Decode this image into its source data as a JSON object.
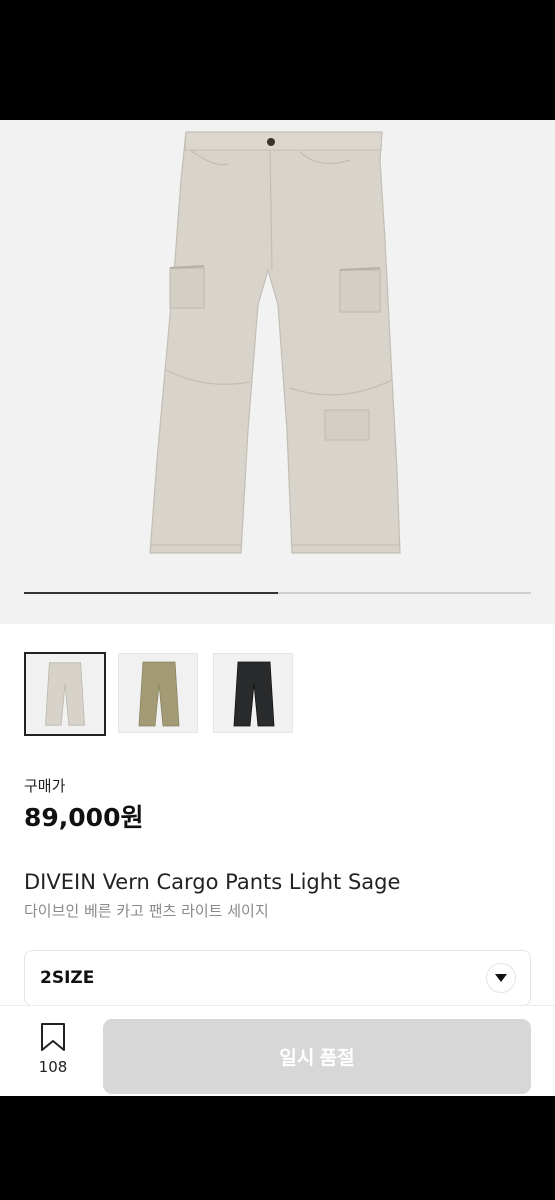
{
  "product": {
    "price_label": "구매가",
    "price": "89,000원",
    "name_en": "DIVEIN Vern Cargo Pants Light Sage",
    "name_ko": "다이브인 베른 카고 팬츠 라이트 세이지"
  },
  "gallery": {
    "progress": 0.5,
    "thumbnails": [
      {
        "color": "#d8d3ca",
        "selected": true
      },
      {
        "color": "#a39b76",
        "selected": false
      },
      {
        "color": "#2a2b2c",
        "selected": false
      }
    ]
  },
  "size_select": {
    "value": "2SIZE",
    "icon": "chevron-down-icon"
  },
  "bottom_bar": {
    "wishlist_count": "108",
    "wishlist_icon": "bookmark-icon",
    "action_label": "일시 품절"
  },
  "colors": {
    "pants_main": "#d9d4cb",
    "button_disabled": "#d7d7d7"
  }
}
